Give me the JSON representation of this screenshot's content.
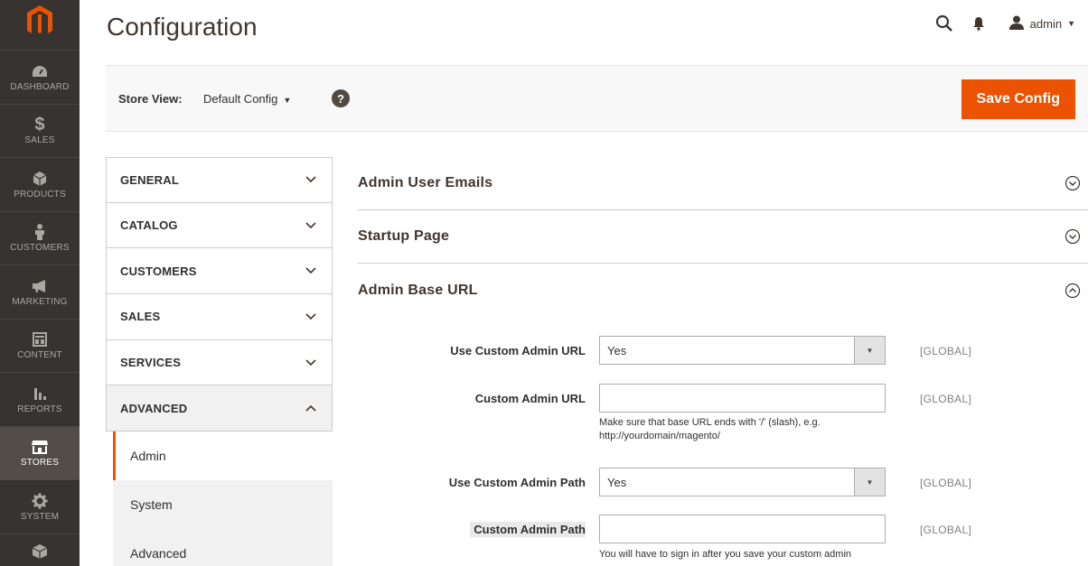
{
  "nav": {
    "items": [
      {
        "label": "DASHBOARD",
        "icon": "dashboard-icon"
      },
      {
        "label": "SALES",
        "icon": "dollar-icon"
      },
      {
        "label": "PRODUCTS",
        "icon": "box-icon"
      },
      {
        "label": "CUSTOMERS",
        "icon": "person-icon"
      },
      {
        "label": "MARKETING",
        "icon": "megaphone-icon"
      },
      {
        "label": "CONTENT",
        "icon": "layout-icon"
      },
      {
        "label": "REPORTS",
        "icon": "bar-chart-icon"
      },
      {
        "label": "STORES",
        "icon": "storefront-icon"
      },
      {
        "label": "SYSTEM",
        "icon": "gear-icon"
      }
    ],
    "active": "STORES",
    "accent": "#eb5202"
  },
  "header": {
    "title": "Configuration",
    "user": "admin"
  },
  "actions": {
    "store_view_label": "Store View:",
    "store_view_value": "Default Config",
    "help": "?",
    "save_label": "Save Config"
  },
  "tabs": {
    "items": [
      {
        "label": "GENERAL",
        "state": "collapsed"
      },
      {
        "label": "CATALOG",
        "state": "collapsed"
      },
      {
        "label": "CUSTOMERS",
        "state": "collapsed"
      },
      {
        "label": "SALES",
        "state": "collapsed"
      },
      {
        "label": "SERVICES",
        "state": "collapsed"
      },
      {
        "label": "ADVANCED",
        "state": "expanded"
      }
    ],
    "sub_items": [
      {
        "label": "Admin",
        "active": true
      },
      {
        "label": "System",
        "active": false
      },
      {
        "label": "Advanced",
        "active": false
      }
    ]
  },
  "sections": [
    {
      "title": "Admin User Emails",
      "state": "collapsed"
    },
    {
      "title": "Startup Page",
      "state": "collapsed"
    },
    {
      "title": "Admin Base URL",
      "state": "expanded"
    }
  ],
  "fields": {
    "use_custom_admin_url": {
      "label": "Use Custom Admin URL",
      "value": "Yes",
      "scope": "[GLOBAL]"
    },
    "custom_admin_url": {
      "label": "Custom Admin URL",
      "value": "",
      "scope": "[GLOBAL]",
      "note_line1": "Make sure that base URL ends with '/' (slash), e.g.",
      "note_line2": "http://yourdomain/magento/"
    },
    "use_custom_admin_path": {
      "label": "Use Custom Admin Path",
      "value": "Yes",
      "scope": "[GLOBAL]"
    },
    "custom_admin_path": {
      "label": "Custom Admin Path",
      "value": "",
      "scope": "[GLOBAL]",
      "note_line1": "You will have to sign in after you save your custom admin"
    }
  }
}
